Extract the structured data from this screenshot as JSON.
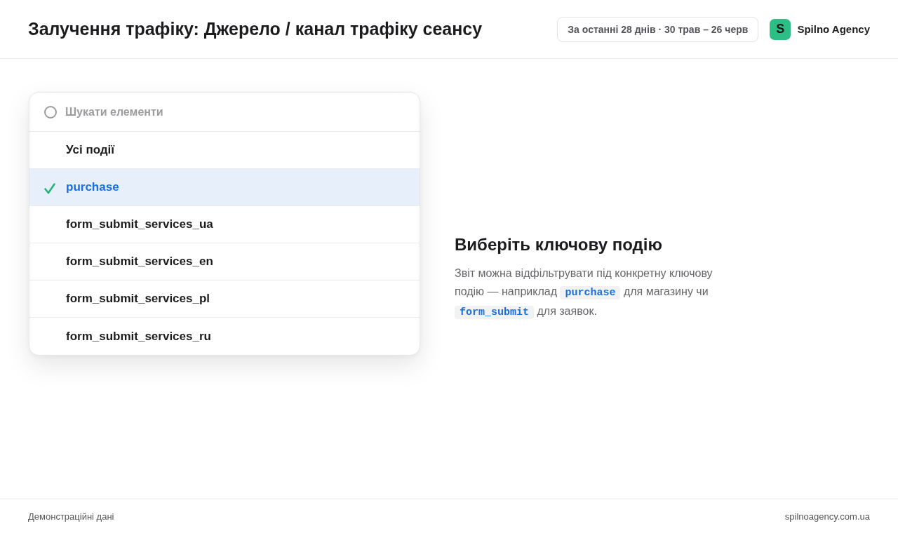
{
  "header": {
    "title": "Залучення трафіку: Джерело / канал трафіку сеансу",
    "date_range": "За останні 28 днів · 30 трав – 26 черв",
    "brand": {
      "initial": "S",
      "name": "Spilno Agency"
    }
  },
  "dropdown": {
    "search": {
      "placeholder": "Шукати елементи"
    },
    "items": [
      {
        "label": "Усі події",
        "selected": false
      },
      {
        "label": "purchase",
        "selected": true
      },
      {
        "label": "form_submit_services_ua",
        "selected": false
      },
      {
        "label": "form_submit_services_en",
        "selected": false
      },
      {
        "label": "form_submit_services_pl",
        "selected": false
      },
      {
        "label": "form_submit_services_ru",
        "selected": false
      }
    ]
  },
  "empty_state": {
    "heading": "Виберіть ключову подію",
    "text": "Звіт можна відфільтрувати під конкретну ключову подію — наприклад **purchase** для магазину чи **form_submit** для заявок."
  },
  "footer": {
    "note": "Демонстраційні дані",
    "site": "spilnoagency.com.ua"
  }
}
